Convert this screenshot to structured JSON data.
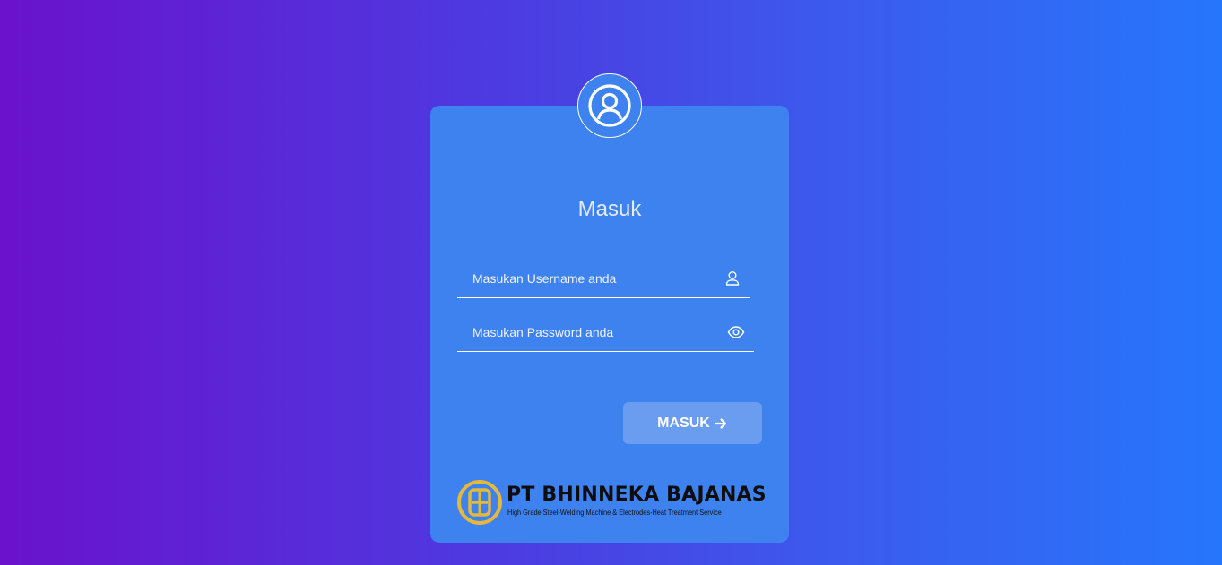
{
  "colors": {
    "gradient_start": "#6a12cc",
    "gradient_end": "#2676fb",
    "card": "#3d82ef",
    "button": "#6a9cf0",
    "logo_gold": "#e4b83a"
  },
  "header": {
    "avatar_icon": "user-circle-icon"
  },
  "form": {
    "title": "Masuk",
    "username": {
      "value": "",
      "placeholder": "Masukan Username anda",
      "icon": "user-icon"
    },
    "password": {
      "value": "",
      "placeholder": "Masukan Password anda",
      "icon": "eye-icon"
    },
    "submit_label": "MASUK",
    "submit_icon": "arrow-right-icon"
  },
  "company": {
    "name": "PT BHINNEKA BAJANAS",
    "tagline": "High Grade Steel-Welding Machine & Electrodes-Heat Treatment Service"
  }
}
